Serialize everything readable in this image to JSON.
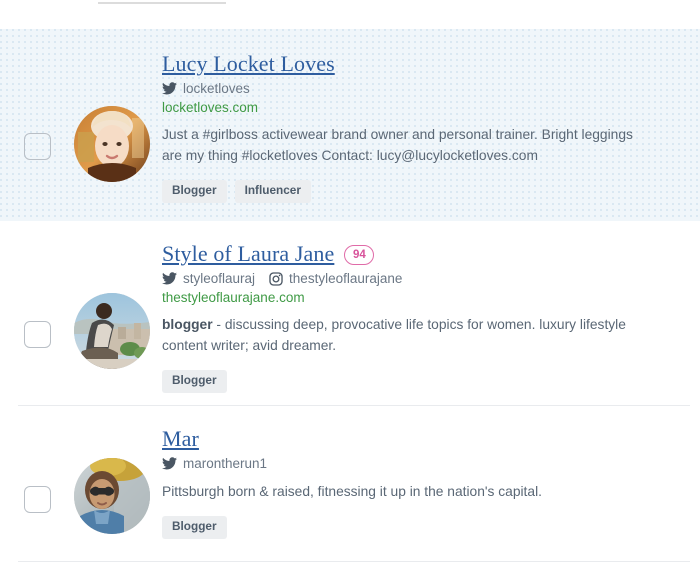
{
  "page": {
    "title": "Influencer search results list"
  },
  "icons": {
    "twitter": "twitter-icon",
    "instagram": "instagram-icon",
    "checkbox": "checkbox-unchecked-icon"
  },
  "colors": {
    "selected_row_bg": "#f0f6fa",
    "selected_row_dots": "#dae8f2",
    "name_link": "#2e5d9f",
    "website_link": "#3f9a45",
    "bio_text": "#5a6775",
    "handle_text": "#6b7785",
    "tag_bg": "#eceef0",
    "tag_text": "#4e5c6b",
    "score_badge_border": "#e06ba8",
    "score_badge_text": "#d8539b",
    "separator": "#e9ebee",
    "checkbox_border": "#b9bfc6"
  },
  "results": [
    {
      "name": "Lucy Locket Loves",
      "selected": true,
      "score": null,
      "twitter_handle": "locketloves",
      "instagram_handle": null,
      "website": "locketloves.com",
      "bio_bold": "",
      "bio": "Just a #girlboss activewear brand owner and personal trainer. Bright leggings are my thing #locketloves Contact: lucy@lucylocketloves.com",
      "tags": [
        "Blogger",
        "Influencer"
      ],
      "avatar_alt": "Portrait of woman with blonde hair"
    },
    {
      "name": "Style of Laura Jane",
      "selected": false,
      "score": "94",
      "twitter_handle": "styleoflauraj",
      "instagram_handle": "thestyleoflaurajane",
      "website": "thestyleoflaurajane.com",
      "bio_bold": "blogger",
      "bio": " - discussing deep, provocative life topics for women. luxury lifestyle content writer; avid dreamer.",
      "tags": [
        "Blogger"
      ],
      "avatar_alt": "Person seated overlooking a city view"
    },
    {
      "name": "Mar",
      "selected": false,
      "score": null,
      "twitter_handle": "marontherun1",
      "instagram_handle": null,
      "website": null,
      "bio_bold": "",
      "bio": "Pittsburgh born & raised, fitnessing it up in the nation's capital.",
      "tags": [
        "Blogger"
      ],
      "avatar_alt": "Woman wearing sunglasses and scarf by the water"
    }
  ]
}
